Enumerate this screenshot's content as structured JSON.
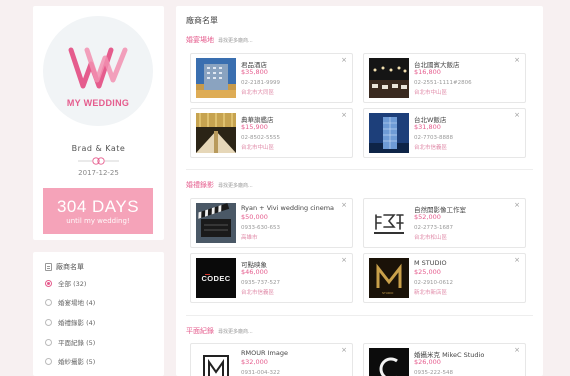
{
  "profile": {
    "logo_text": "MY WEDDING",
    "couple": "Brad & Kate",
    "date": "2017-12-25",
    "countdown_days": "304 DAYS",
    "countdown_sub": "until my wedding!",
    "brand_color": "#e55c8d",
    "countdown_color": "#f5a3b9"
  },
  "filter": {
    "title": "廠商名單",
    "options": [
      {
        "label": "全部 (32)",
        "checked": true
      },
      {
        "label": "婚宴場地 (4)",
        "checked": false
      },
      {
        "label": "婚禮錄影 (4)",
        "checked": false
      },
      {
        "label": "平面紀錄 (5)",
        "checked": false
      },
      {
        "label": "婚紗攝影 (5)",
        "checked": false
      }
    ]
  },
  "main": {
    "title": "廠商名單",
    "sections": [
      {
        "title": "婚宴場地",
        "more": "尋找更多廠商...",
        "vendors": [
          {
            "name": "君品酒店",
            "price": "$35,800",
            "phone": "02-2181-9999",
            "address": "台北市大同區",
            "thumb_icon": "hotel-building-photo"
          },
          {
            "name": "台北國賓大飯店",
            "price": "$16,800",
            "phone": "02-2551-1111#2806",
            "address": "台北市中山區",
            "thumb_icon": "banquet-hall-photo"
          },
          {
            "name": "典華旗艦店",
            "price": "$15,900",
            "phone": "02-8502-5555",
            "address": "台北市中山區",
            "thumb_icon": "ballroom-photo"
          },
          {
            "name": "台北W飯店",
            "price": "$31,800",
            "phone": "02-7703-8888",
            "address": "台北市信義區",
            "thumb_icon": "tower-photo"
          }
        ]
      },
      {
        "title": "婚禮錄影",
        "more": "尋找更多廠商...",
        "vendors": [
          {
            "name": "Ryan + Vivi wedding cinema",
            "price": "$50,000",
            "phone": "0933-630-653",
            "address": "高雄市",
            "thumb_icon": "film-clapper-photo"
          },
          {
            "name": "自然開影像工作室",
            "price": "$52,000",
            "phone": "02-2773-1687",
            "address": "台北市松山區",
            "thumb_icon": "studio-logo"
          },
          {
            "name": "可點映象",
            "price": "$46,000",
            "phone": "0935-737-527",
            "address": "台北市信義區",
            "thumb_icon": "codec-logo"
          },
          {
            "name": "M STUDIO",
            "price": "$25,000",
            "phone": "02-2910-0612",
            "address": "新北市新店區",
            "thumb_icon": "m-studio-logo"
          }
        ]
      },
      {
        "title": "平面紀錄",
        "more": "尋找更多廠商...",
        "vendors": [
          {
            "name": "RMOUR Image",
            "price": "$32,000",
            "phone": "0931-004-322",
            "address": "",
            "thumb_icon": "rmour-logo"
          },
          {
            "name": "婚攝米克 MikeC Studio",
            "price": "$26,000",
            "phone": "0935-222-548",
            "address": "",
            "thumb_icon": "mikec-logo"
          }
        ]
      }
    ]
  }
}
